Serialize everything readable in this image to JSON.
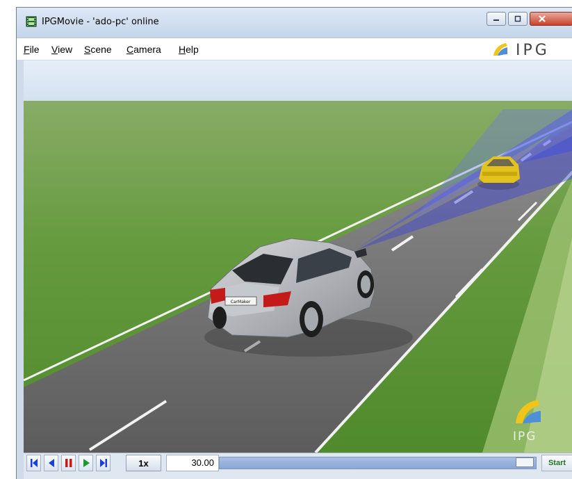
{
  "window": {
    "title": "IPGMovie - 'ado-pc' online"
  },
  "menu": {
    "items": [
      {
        "label_first": "F",
        "label_rest": "ile"
      },
      {
        "label_first": "V",
        "label_rest": "iew"
      },
      {
        "label_first": "S",
        "label_rest": "cene"
      },
      {
        "label_first": "C",
        "label_rest": "amera"
      },
      {
        "label_first": "H",
        "label_rest": "elp"
      }
    ],
    "brand": "IPG"
  },
  "scene": {
    "watermark": "IPG",
    "car_plate": "CarMaker"
  },
  "controls": {
    "speed": "1x",
    "time": "30.00",
    "start_label": "Start",
    "playback_progress": 0.94
  },
  "colors": {
    "sky": "#dfeaf6",
    "grass": "#5f9b3c",
    "road": "#6a6a6a",
    "sensor_beam": "#4b55e6",
    "target_car": "#e3c21d",
    "ego_car": "#b9bcc1",
    "start_green": "#1a7a22"
  }
}
